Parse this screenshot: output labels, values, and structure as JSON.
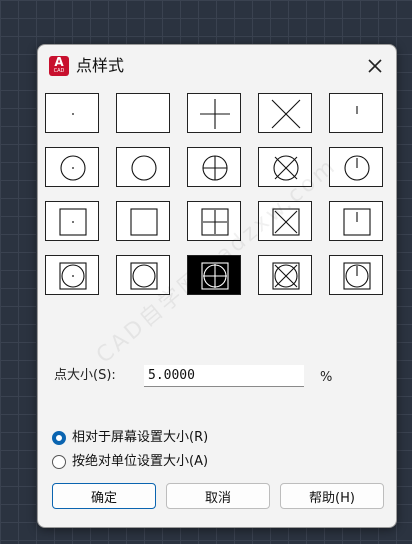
{
  "dialog": {
    "title": "点样式",
    "app_icon_letter": "A",
    "app_icon_caption": "CAD",
    "close_icon": "close-icon"
  },
  "point_styles": [
    {
      "shape": "dot",
      "selected": false
    },
    {
      "shape": "none",
      "selected": false
    },
    {
      "shape": "plus",
      "selected": false
    },
    {
      "shape": "cross",
      "selected": false
    },
    {
      "shape": "tick",
      "selected": false
    },
    {
      "shape": "circle-dot",
      "selected": false
    },
    {
      "shape": "circle",
      "selected": false
    },
    {
      "shape": "circle-plus",
      "selected": false
    },
    {
      "shape": "circle-cross",
      "selected": false
    },
    {
      "shape": "circle-tick",
      "selected": false
    },
    {
      "shape": "square-dot",
      "selected": false
    },
    {
      "shape": "square",
      "selected": false
    },
    {
      "shape": "square-plus",
      "selected": false
    },
    {
      "shape": "square-cross",
      "selected": false
    },
    {
      "shape": "square-tick",
      "selected": false
    },
    {
      "shape": "square-circle-dot",
      "selected": false
    },
    {
      "shape": "square-circle",
      "selected": false
    },
    {
      "shape": "square-circle-plus",
      "selected": true
    },
    {
      "shape": "square-circle-cross",
      "selected": false
    },
    {
      "shape": "square-circle-tick",
      "selected": false
    }
  ],
  "size": {
    "label": "点大小(S):",
    "value": "5.0000",
    "unit": "%"
  },
  "options": {
    "relative_label": "相对于屏幕设置大小(R)",
    "absolute_label": "按绝对单位设置大小(A)",
    "selected": "relative"
  },
  "buttons": {
    "ok": "确定",
    "cancel": "取消",
    "help": "帮助(H)"
  },
  "watermark": "CAD自学网 cadzxw.com",
  "colors": {
    "accent": "#0a64b0",
    "brand_red": "#c8102e"
  }
}
